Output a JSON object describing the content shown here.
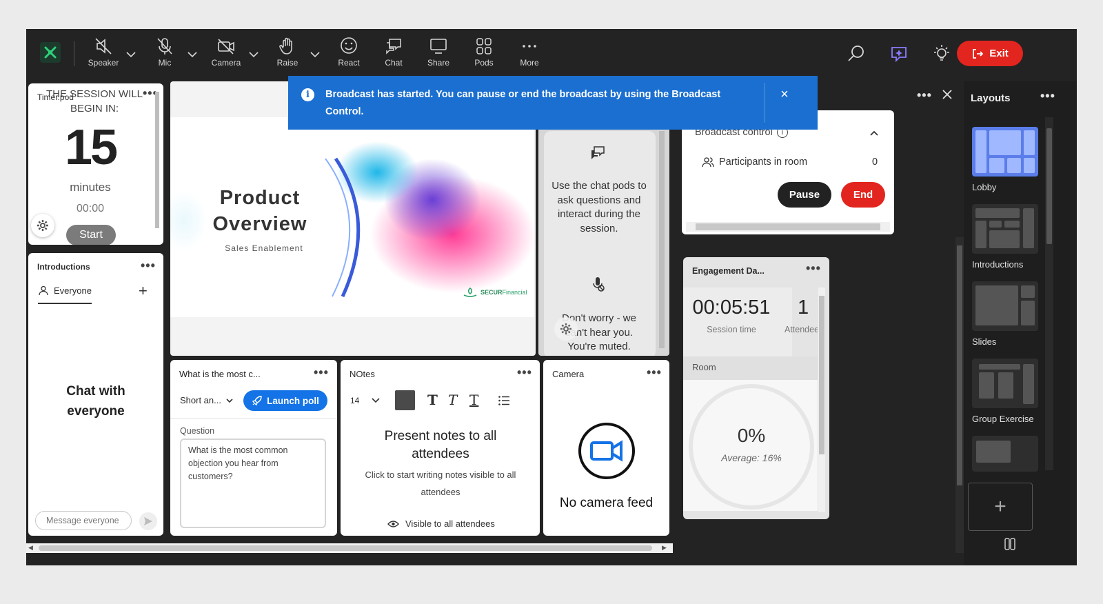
{
  "toolbar": {
    "speaker": "Speaker",
    "mic": "Mic",
    "camera": "Camera",
    "raise": "Raise",
    "react": "React",
    "chat": "Chat",
    "share": "Share",
    "pods": "Pods",
    "more": "More",
    "exit": "Exit"
  },
  "banner": {
    "text": "Broadcast has started. You can pause or end the broadcast by using the Broadcast Control.",
    "close": "×"
  },
  "timer_pod": {
    "title": "Timer.pod",
    "heading": "THE SESSION WILL BEGIN IN:",
    "number": "15",
    "unit": "minutes",
    "time": "00:00",
    "start": "Start"
  },
  "intro_pod": {
    "title": "Introductions",
    "tab": "Everyone",
    "body": "Chat with everyone",
    "placeholder": "Message everyone"
  },
  "slide": {
    "title_line1": "Product",
    "title_line2": "Overview",
    "subtitle": "Sales Enablement",
    "brand": "SECUR",
    "brand_suffix": "Financial"
  },
  "chat_tip": {
    "text1": "Use the chat pods to ask questions and interact during the session.",
    "text2": "Don't worry - we can't hear you. You're muted."
  },
  "poll_pod": {
    "title": "What is the most c...",
    "type": "Short an...",
    "launch": "Launch poll",
    "question_label": "Question",
    "question": "What is the most common objection you hear from customers?"
  },
  "notes_pod": {
    "title": "NOtes",
    "font_size": "14",
    "heading": "Present notes to all attendees",
    "body": "Click to start writing notes visible to all attendees",
    "visibility": "Visible to all attendees"
  },
  "camera_pod": {
    "title": "Camera",
    "empty": "No camera feed"
  },
  "broadcast": {
    "title": "Broadcast control",
    "participants_label": "Participants in room",
    "participants_count": "0",
    "pause": "Pause",
    "end": "End"
  },
  "engagement": {
    "title": "Engagement Da...",
    "session_time": "00:05:51",
    "session_time_label": "Session time",
    "attendees": "1",
    "attendees_label": "Attendees",
    "room_label": "Room",
    "percent": "0%",
    "percent_value": 0,
    "average": "Average: 16%"
  },
  "layouts": {
    "title": "Layouts",
    "items": [
      "Lobby",
      "Introductions",
      "Slides",
      "Group Exercise"
    ]
  },
  "colors": {
    "accent_blue": "#1a6fd0",
    "exit_red": "#e2251e",
    "selected_layout": "#5a7dea",
    "launch_blue": "#1473e6"
  }
}
